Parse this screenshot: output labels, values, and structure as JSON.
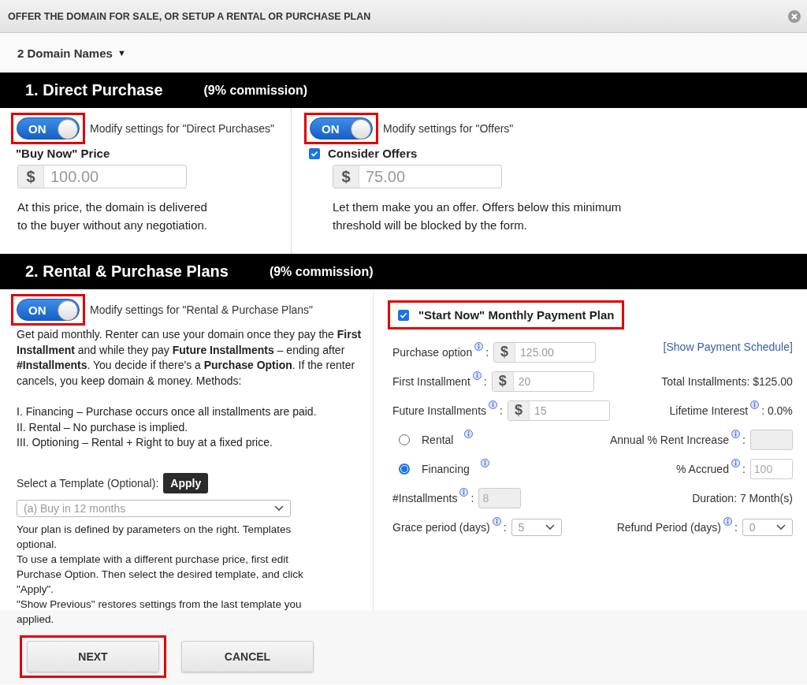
{
  "window": {
    "title": "OFFER THE DOMAIN FOR SALE, OR SETUP A RENTAL OR PURCHASE PLAN"
  },
  "domains": {
    "label": "2 Domain Names",
    "caret": "▼"
  },
  "direct": {
    "title": "1. Direct Purchase",
    "commission": "(9% commission)",
    "columns": [
      {
        "toggle": {
          "label": "ON",
          "on": true,
          "highlighted": true
        },
        "caption": "Modify settings for \"Direct Purchases\"",
        "kind": "heading",
        "heading": "\"Buy Now\" Price",
        "prefix": "$",
        "value": "100.00",
        "description": "At this price, the domain is delivered\nto the buyer without any negotiation."
      },
      {
        "toggle": {
          "label": "ON",
          "on": true,
          "highlighted": true
        },
        "caption": "Modify settings for \"Offers\"",
        "kind": "checkbox",
        "heading": "Consider Offers",
        "checked": true,
        "prefix": "$",
        "value": "75.00",
        "description": "Let them make you an offer. Offers below this minimum\nthreshold will be blocked by the form."
      }
    ]
  },
  "plans": {
    "title": "2. Rental & Purchase Plans",
    "commission": "(9% commission)",
    "toggle": {
      "label": "ON",
      "on": true,
      "highlighted": true
    },
    "caption": "Modify settings for \"Rental & Purchase Plans\"",
    "description": "Get paid monthly. Renter can use your domain once they pay the **First Installment** and while they pay **Future Installments** – ending after **#Installments**. You decide if there's a **Purchase Option**. If the renter cancels, you keep domain & money. Methods:\n\nI. Financing – Purchase occurs once all installments are paid.\nII. Rental – No purchase is implied.\nIII. Optioning – Rental + Right to buy at a fixed price.",
    "template_label": "Select a Template (Optional):",
    "apply": "Apply",
    "template": "(a) Buy in 12 months",
    "template_help": "Your plan is defined by parameters on the right. Templates optional.\nTo use a template with a different purchase price, first edit Purchase Option. Then select the desired template, and click \"Apply\".\n\"Show Previous\" restores settings from the last template you applied.",
    "plan": {
      "label": "\"Start Now\" Monthly Payment Plan",
      "checked": true,
      "highlighted": true,
      "rows": [
        [
          {
            "kind": "money",
            "label": "Purchase option",
            "colon": ":",
            "prefix": "$",
            "value": "125.00"
          },
          {
            "kind": "link",
            "text": "[Show Payment Schedule]"
          }
        ],
        [
          {
            "kind": "money",
            "label": "First Installment",
            "colon": ":",
            "prefix": "$",
            "value": "20"
          },
          {
            "kind": "text",
            "text": "Total Installments: $125.00"
          }
        ],
        [
          {
            "kind": "money",
            "label": "Future Installments",
            "colon": ":",
            "prefix": "$",
            "value": "15"
          },
          {
            "kind": "readout",
            "label": "Lifetime Interest",
            "value": ": 0.0%"
          }
        ],
        [
          {
            "kind": "radio",
            "label": "Rental",
            "selected": false
          },
          {
            "kind": "input",
            "label": "Annual % Rent Increase",
            "colon": ":",
            "disabled": true
          }
        ],
        [
          {
            "kind": "radio",
            "label": "Financing",
            "selected": true
          },
          {
            "kind": "input",
            "label": "% Accrued",
            "colon": ":",
            "value": "100",
            "disabled": false
          }
        ],
        [
          {
            "kind": "input",
            "label": "#Installments",
            "colon": ":",
            "value": "8",
            "disabled": true
          },
          {
            "kind": "text",
            "text": "Duration: 7 Month(s)"
          }
        ],
        [
          {
            "kind": "select",
            "label": "Grace period (days)",
            "colon": ":",
            "value": "5"
          },
          {
            "kind": "select",
            "label": "Refund Period (days)",
            "colon": ":",
            "value": "0"
          }
        ]
      ]
    }
  },
  "buttons": [
    {
      "label": "NEXT",
      "highlighted": true
    },
    {
      "label": "CANCEL",
      "highlighted": false
    }
  ]
}
